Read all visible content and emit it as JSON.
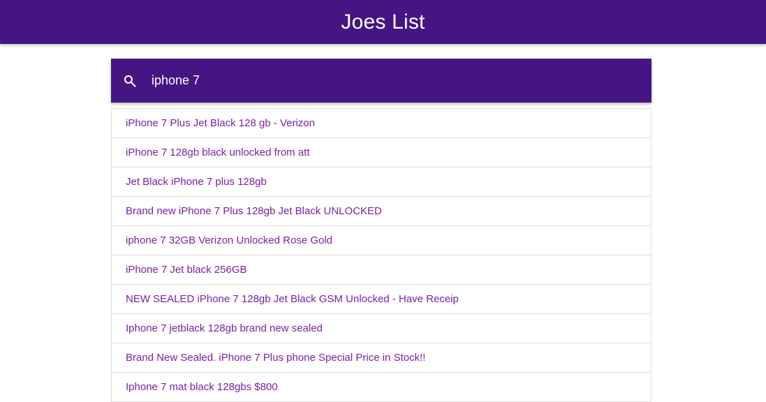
{
  "header": {
    "title": "Joes List",
    "color": "#451583"
  },
  "search": {
    "icon": "search-icon",
    "value": "iphone 7",
    "background": "#451583"
  },
  "results": [
    {
      "label": "iPhone 7 Plus Jet Black 128 gb - Verizon"
    },
    {
      "label": "iPhone 7 128gb black unlocked from att"
    },
    {
      "label": "Jet Black iPhone 7 plus 128gb"
    },
    {
      "label": "Brand new iPhone 7 Plus 128gb Jet Black UNLOCKED"
    },
    {
      "label": "iphone 7 32GB Verizon Unlocked Rose Gold"
    },
    {
      "label": "iPhone 7 Jet black 256GB"
    },
    {
      "label": "NEW SEALED iPhone 7 128gb Jet Black GSM Unlocked - Have Receip"
    },
    {
      "label": "Iphone 7 jetblack 128gb brand new sealed"
    },
    {
      "label": "Brand New Sealed. iPhone 7 Plus phone Special Price in Stock!!"
    },
    {
      "label": "Iphone 7 mat black 128gbs $800"
    }
  ],
  "link_color": "#7b1fa2"
}
